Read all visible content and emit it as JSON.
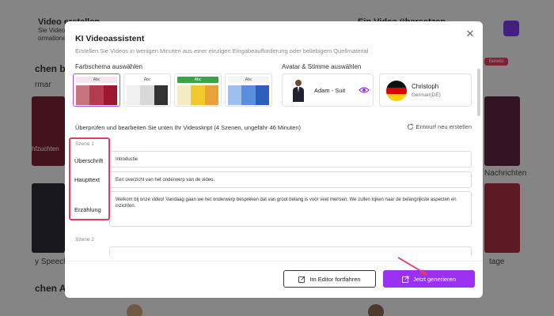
{
  "background": {
    "top_left_title": "Video erstellen",
    "top_left_sub1": "Sie Videos in wenigen",
    "top_left_sub2": "ormationen",
    "top_right_title": "Ein Video übersetzen",
    "section_begin": "chen beginne",
    "section_begin_sub": "rmar",
    "beliebt": "Beliebt",
    "left_caption": "hfzuchten",
    "right_caption": "Nachrichten",
    "bottom_left": "y Speech",
    "bottom_right": "tage",
    "bottom_section": "chen Ava"
  },
  "modal": {
    "title": "KI Videoassistent",
    "subtitle": "Erstellen Sie Videos in wenigen Minuten aus einer einzigen Eingabeaufforderung oder beliebigem Quellmaterial",
    "color_scheme_label": "Farbschema auswählen",
    "avatar_voice_label": "Avatar & Stimme auswählen",
    "schemes": [
      {
        "header": "Abc",
        "header_color": "#f3e6ee",
        "colors": [
          "#c5737f",
          "#b53c4f",
          "#9b1830"
        ],
        "selected": true
      },
      {
        "header": "Abc",
        "header_color": "#ffffff",
        "colors": [
          "#f0f0f0",
          "#d8d8d8",
          "#333333"
        ],
        "selected": false
      },
      {
        "header": "Abc",
        "header_color": "#3aa24a",
        "colors": [
          "#f3ecc0",
          "#f2c82c",
          "#e7a33a"
        ],
        "selected": false
      },
      {
        "header": "Abc",
        "header_color": "#f5f5f5",
        "colors": [
          "#9ec0ef",
          "#5a8fe0",
          "#2e5fbf"
        ],
        "selected": false
      }
    ],
    "avatar_name": "Adam - Suit",
    "voice_name": "Christoph",
    "voice_lang": "German(DE)",
    "review_text": "Überprüfen und bearbeiten Sie unten Ihr Videoskript (4 Szenen, ungefähr 46 Minuten)",
    "regenerate_label": "Entwurf neu erstellen",
    "scene1_label": "Szene 1",
    "scene2_label": "Szene 2",
    "heading_label": "Überschrift",
    "heading_value": "Introductie",
    "main_text_label": "Haupttext",
    "main_text_value": "Een overzicht van het onderwerp van de video.",
    "narration_label": "Erzählung",
    "narration_value": "Welkom bij onze video! Vandaag gaan we het onderwerp bespreken dat van groot belang is voor veel mensen. We zullen kijken naar de belangrijkste aspecten en inzichten.",
    "editor_button": "Im Editor fortfahren",
    "generate_button": "Jetzt generieren",
    "accent_color": "#9b30f0",
    "highlight_color": "#e53e5c"
  }
}
